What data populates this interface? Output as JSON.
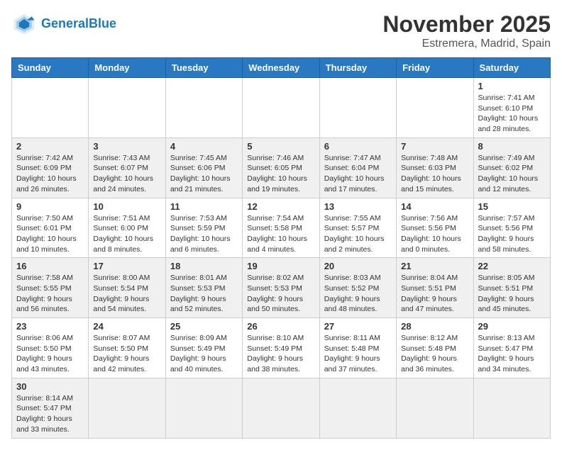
{
  "header": {
    "logo_general": "General",
    "logo_blue": "Blue",
    "month": "November 2025",
    "location": "Estremera, Madrid, Spain"
  },
  "weekdays": [
    "Sunday",
    "Monday",
    "Tuesday",
    "Wednesday",
    "Thursday",
    "Friday",
    "Saturday"
  ],
  "weeks": [
    [
      {
        "day": "",
        "info": ""
      },
      {
        "day": "",
        "info": ""
      },
      {
        "day": "",
        "info": ""
      },
      {
        "day": "",
        "info": ""
      },
      {
        "day": "",
        "info": ""
      },
      {
        "day": "",
        "info": ""
      },
      {
        "day": "1",
        "info": "Sunrise: 7:41 AM\nSunset: 6:10 PM\nDaylight: 10 hours and 28 minutes."
      }
    ],
    [
      {
        "day": "2",
        "info": "Sunrise: 7:42 AM\nSunset: 6:09 PM\nDaylight: 10 hours and 26 minutes."
      },
      {
        "day": "3",
        "info": "Sunrise: 7:43 AM\nSunset: 6:07 PM\nDaylight: 10 hours and 24 minutes."
      },
      {
        "day": "4",
        "info": "Sunrise: 7:45 AM\nSunset: 6:06 PM\nDaylight: 10 hours and 21 minutes."
      },
      {
        "day": "5",
        "info": "Sunrise: 7:46 AM\nSunset: 6:05 PM\nDaylight: 10 hours and 19 minutes."
      },
      {
        "day": "6",
        "info": "Sunrise: 7:47 AM\nSunset: 6:04 PM\nDaylight: 10 hours and 17 minutes."
      },
      {
        "day": "7",
        "info": "Sunrise: 7:48 AM\nSunset: 6:03 PM\nDaylight: 10 hours and 15 minutes."
      },
      {
        "day": "8",
        "info": "Sunrise: 7:49 AM\nSunset: 6:02 PM\nDaylight: 10 hours and 12 minutes."
      }
    ],
    [
      {
        "day": "9",
        "info": "Sunrise: 7:50 AM\nSunset: 6:01 PM\nDaylight: 10 hours and 10 minutes."
      },
      {
        "day": "10",
        "info": "Sunrise: 7:51 AM\nSunset: 6:00 PM\nDaylight: 10 hours and 8 minutes."
      },
      {
        "day": "11",
        "info": "Sunrise: 7:53 AM\nSunset: 5:59 PM\nDaylight: 10 hours and 6 minutes."
      },
      {
        "day": "12",
        "info": "Sunrise: 7:54 AM\nSunset: 5:58 PM\nDaylight: 10 hours and 4 minutes."
      },
      {
        "day": "13",
        "info": "Sunrise: 7:55 AM\nSunset: 5:57 PM\nDaylight: 10 hours and 2 minutes."
      },
      {
        "day": "14",
        "info": "Sunrise: 7:56 AM\nSunset: 5:56 PM\nDaylight: 10 hours and 0 minutes."
      },
      {
        "day": "15",
        "info": "Sunrise: 7:57 AM\nSunset: 5:56 PM\nDaylight: 9 hours and 58 minutes."
      }
    ],
    [
      {
        "day": "16",
        "info": "Sunrise: 7:58 AM\nSunset: 5:55 PM\nDaylight: 9 hours and 56 minutes."
      },
      {
        "day": "17",
        "info": "Sunrise: 8:00 AM\nSunset: 5:54 PM\nDaylight: 9 hours and 54 minutes."
      },
      {
        "day": "18",
        "info": "Sunrise: 8:01 AM\nSunset: 5:53 PM\nDaylight: 9 hours and 52 minutes."
      },
      {
        "day": "19",
        "info": "Sunrise: 8:02 AM\nSunset: 5:53 PM\nDaylight: 9 hours and 50 minutes."
      },
      {
        "day": "20",
        "info": "Sunrise: 8:03 AM\nSunset: 5:52 PM\nDaylight: 9 hours and 48 minutes."
      },
      {
        "day": "21",
        "info": "Sunrise: 8:04 AM\nSunset: 5:51 PM\nDaylight: 9 hours and 47 minutes."
      },
      {
        "day": "22",
        "info": "Sunrise: 8:05 AM\nSunset: 5:51 PM\nDaylight: 9 hours and 45 minutes."
      }
    ],
    [
      {
        "day": "23",
        "info": "Sunrise: 8:06 AM\nSunset: 5:50 PM\nDaylight: 9 hours and 43 minutes."
      },
      {
        "day": "24",
        "info": "Sunrise: 8:07 AM\nSunset: 5:50 PM\nDaylight: 9 hours and 42 minutes."
      },
      {
        "day": "25",
        "info": "Sunrise: 8:09 AM\nSunset: 5:49 PM\nDaylight: 9 hours and 40 minutes."
      },
      {
        "day": "26",
        "info": "Sunrise: 8:10 AM\nSunset: 5:49 PM\nDaylight: 9 hours and 38 minutes."
      },
      {
        "day": "27",
        "info": "Sunrise: 8:11 AM\nSunset: 5:48 PM\nDaylight: 9 hours and 37 minutes."
      },
      {
        "day": "28",
        "info": "Sunrise: 8:12 AM\nSunset: 5:48 PM\nDaylight: 9 hours and 36 minutes."
      },
      {
        "day": "29",
        "info": "Sunrise: 8:13 AM\nSunset: 5:47 PM\nDaylight: 9 hours and 34 minutes."
      }
    ],
    [
      {
        "day": "30",
        "info": "Sunrise: 8:14 AM\nSunset: 5:47 PM\nDaylight: 9 hours and 33 minutes."
      },
      {
        "day": "",
        "info": ""
      },
      {
        "day": "",
        "info": ""
      },
      {
        "day": "",
        "info": ""
      },
      {
        "day": "",
        "info": ""
      },
      {
        "day": "",
        "info": ""
      },
      {
        "day": "",
        "info": ""
      }
    ]
  ]
}
